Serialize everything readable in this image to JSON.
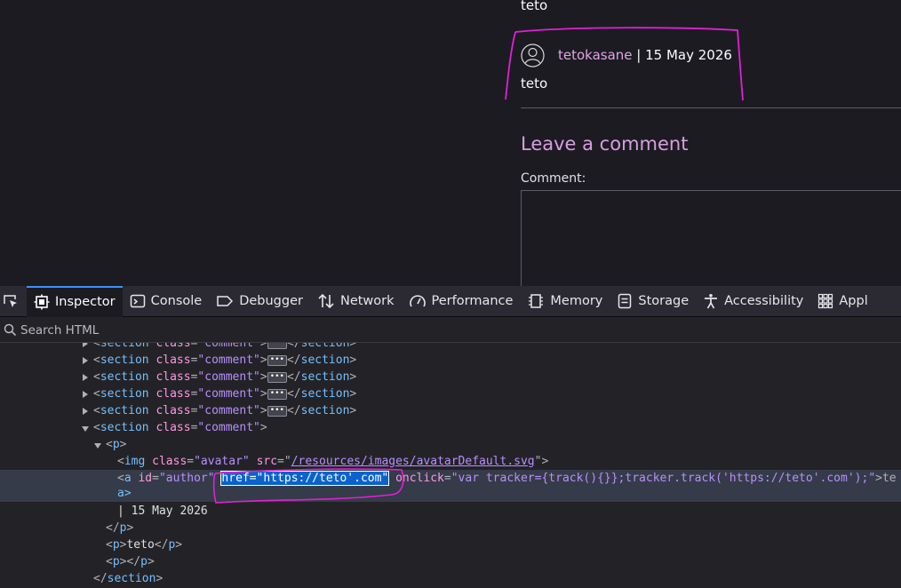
{
  "page": {
    "previous_comment_text": "teto",
    "comment": {
      "author": "tetokasane",
      "separator": " | ",
      "date": "15 May 2026",
      "text": "teto"
    },
    "leave_comment_heading": "Leave a comment",
    "comment_label": "Comment:"
  },
  "devtools": {
    "tabs": [
      {
        "label": "Inspector",
        "icon": "inspector-icon",
        "active": true
      },
      {
        "label": "Console",
        "icon": "console-icon"
      },
      {
        "label": "Debugger",
        "icon": "debugger-icon"
      },
      {
        "label": "Network",
        "icon": "network-icon"
      },
      {
        "label": "Performance",
        "icon": "performance-icon"
      },
      {
        "label": "Memory",
        "icon": "memory-icon"
      },
      {
        "label": "Storage",
        "icon": "storage-icon"
      },
      {
        "label": "Accessibility",
        "icon": "accessibility-icon"
      },
      {
        "label": "Appl",
        "icon": "application-icon"
      }
    ],
    "search_placeholder": "Search HTML",
    "tree": {
      "section_tag": "section",
      "class_attr": "class",
      "comment_class": "\"comment\"",
      "p_tag": "p",
      "img_tag": "img",
      "avatar_class": "\"avatar\"",
      "src_attr": "src",
      "src_value": "/resources/images/avatarDefault.svg",
      "a_tag": "a",
      "id_attr": "id",
      "id_value": "\"author\"",
      "href_selected": "href=\"https://teto'.com\"",
      "onclick_attr": "onclick",
      "onclick_value": "\"var tracker={track(){}};tracker.track('https://teto'.com');\"",
      "a_overflow": ">te",
      "a_close_tail": "a>",
      "date_text": "| 15 May 2026",
      "p_text": "teto"
    }
  },
  "colors": {
    "accent": "#3a91ff",
    "author_link": "#e1a3e6",
    "annotation": "#e020d8",
    "selection": "#0a62cc"
  }
}
